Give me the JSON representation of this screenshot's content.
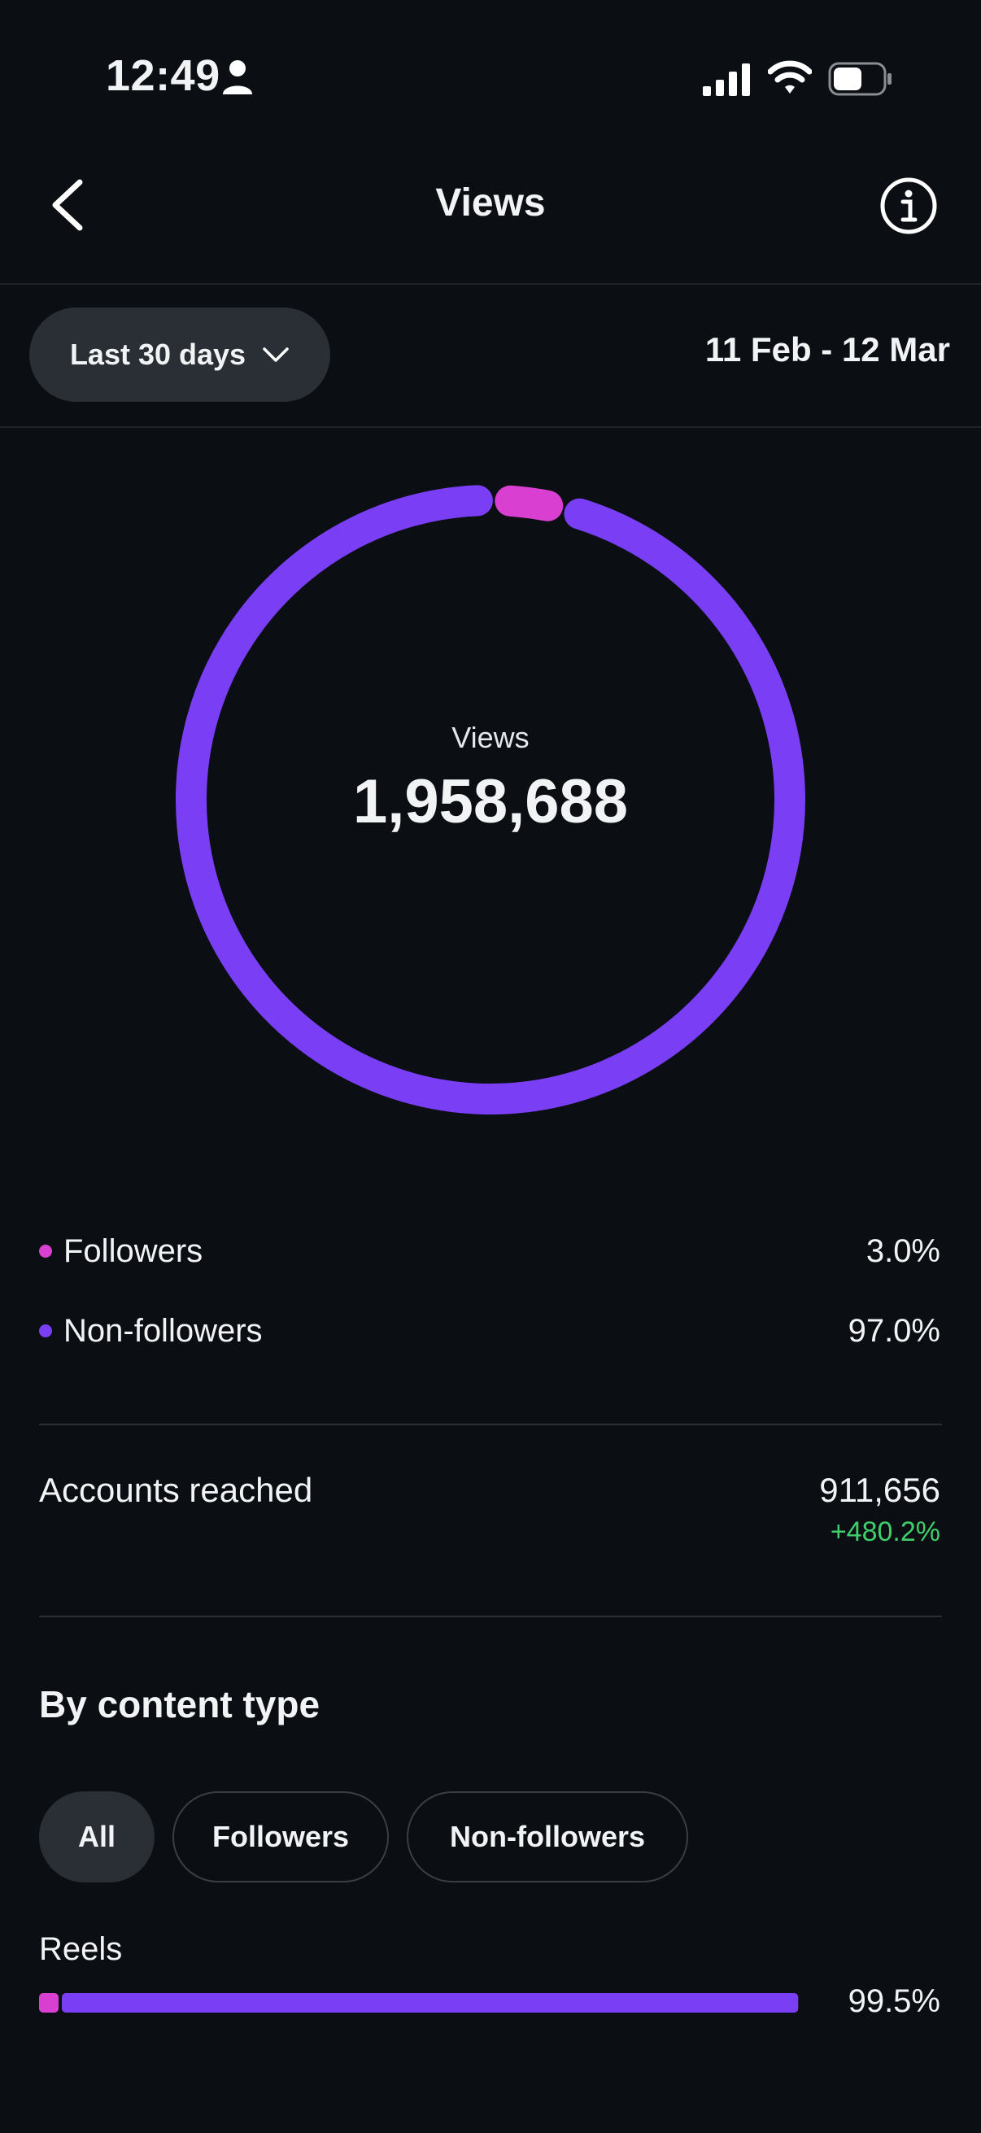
{
  "status_bar": {
    "time": "12:49",
    "icons": [
      "person-icon",
      "signal-icon",
      "wifi-icon",
      "battery-icon"
    ]
  },
  "header": {
    "title": "Views",
    "back_icon": "chevron-left-icon",
    "info_icon": "info-icon"
  },
  "filters": {
    "range_label": "Last 30 days",
    "date_range": "11 Feb - 12 Mar"
  },
  "summary": {
    "label": "Views",
    "total": "1,958,688",
    "breakdown": [
      {
        "label": "Followers",
        "value": "3.0%",
        "fraction": 0.03,
        "color": "#d93fd0"
      },
      {
        "label": "Non-followers",
        "value": "97.0%",
        "fraction": 0.97,
        "color": "#7a3ff5"
      }
    ]
  },
  "accounts_reached": {
    "label": "Accounts reached",
    "value": "911,656",
    "change": "+480.2%",
    "change_color": "#3ecf6b"
  },
  "content_type": {
    "title": "By content type",
    "tabs": [
      {
        "label": "All",
        "active": true
      },
      {
        "label": "Followers",
        "active": false
      },
      {
        "label": "Non-followers",
        "active": false
      }
    ],
    "items": [
      {
        "label": "Reels",
        "percent": "99.5%",
        "fraction": 0.995,
        "followers_share": 0.03
      }
    ]
  },
  "colors": {
    "background": "#0b0e13",
    "followers": "#d93fd0",
    "non_followers": "#7a3ff5",
    "pill": "#2a2e35"
  }
}
